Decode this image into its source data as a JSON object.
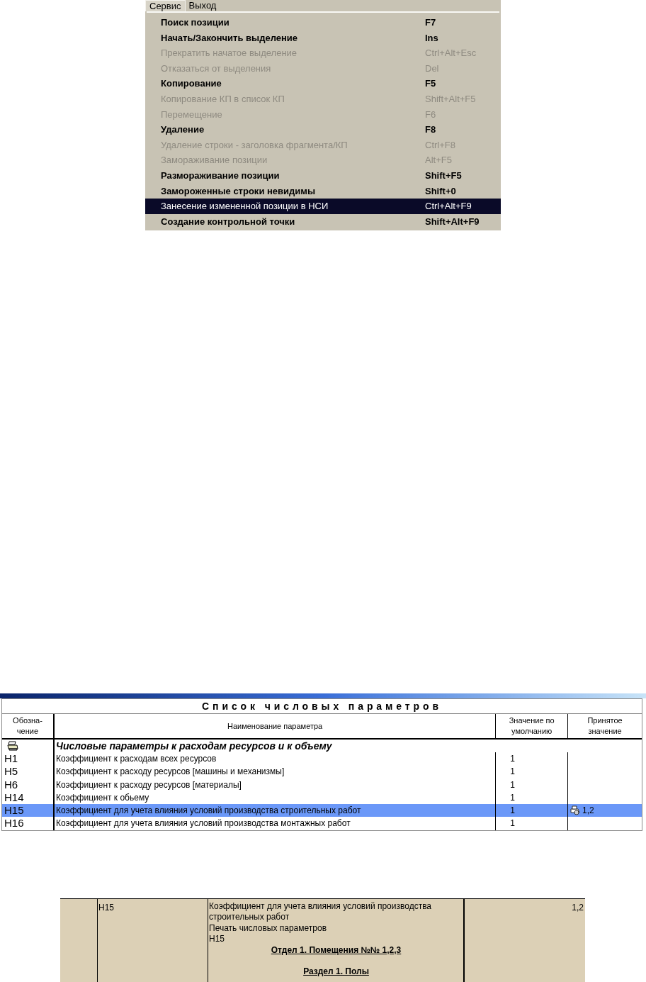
{
  "menu": {
    "menubar": [
      {
        "label": "Сервис",
        "selected": true
      },
      {
        "label": "Выход",
        "selected": false
      }
    ],
    "items": [
      {
        "label": "Поиск позиции",
        "shortcut": "F7",
        "disabled": false,
        "selected": false
      },
      {
        "label": "Начать/Закончить выделение",
        "shortcut": "Ins",
        "disabled": false,
        "selected": false
      },
      {
        "label": "Прекратить начатое выделение",
        "shortcut": "Ctrl+Alt+Esc",
        "disabled": true,
        "selected": false
      },
      {
        "label": "Отказаться от выделения",
        "shortcut": "Del",
        "disabled": true,
        "selected": false
      },
      {
        "label": "Копирование",
        "shortcut": "F5",
        "disabled": false,
        "selected": false
      },
      {
        "label": "Копирование КП в список КП",
        "shortcut": "Shift+Alt+F5",
        "disabled": true,
        "selected": false
      },
      {
        "label": "Перемещение",
        "shortcut": "F6",
        "disabled": true,
        "selected": false
      },
      {
        "label": "Удаление",
        "shortcut": "F8",
        "disabled": false,
        "selected": false
      },
      {
        "label": "Удаление строки - заголовка фрагмента/КП",
        "shortcut": "Ctrl+F8",
        "disabled": true,
        "selected": false
      },
      {
        "label": "Замораживание позиции",
        "shortcut": "Alt+F5",
        "disabled": true,
        "selected": false
      },
      {
        "label": "Размораживание позиции",
        "shortcut": "Shift+F5",
        "disabled": false,
        "selected": false
      },
      {
        "label": "Замороженные строки невидимы",
        "shortcut": "Shift+0",
        "disabled": false,
        "selected": false
      },
      {
        "label": "Занесение измененной позиции в НСИ",
        "shortcut": "Ctrl+Alt+F9",
        "disabled": false,
        "selected": true
      },
      {
        "label": "Создание контрольной точки",
        "shortcut": "Shift+Alt+F9",
        "disabled": false,
        "selected": false
      }
    ]
  },
  "table": {
    "title": "Список числовых параметров",
    "columns": [
      "Обозна-\nчение",
      "Наименование параметра",
      "Значение по\nумолчанию",
      "Принятое\nзначение"
    ],
    "group": {
      "label": "Числовые параметры к расходам ресурсов и к объему"
    },
    "rows": [
      {
        "code": "H1",
        "name": "Коэффициент к расходам всех ресурсов",
        "default": "1",
        "selected": false
      },
      {
        "code": "H5",
        "name": "Коэффициент к расходу ресурсов [машины и механизмы]",
        "default": "1",
        "selected": false
      },
      {
        "code": "H6",
        "name": "Коэффициент к расходу ресурсов [материалы]",
        "default": "1",
        "selected": false
      },
      {
        "code": "H14",
        "name": "Коэффициент к обьему",
        "default": "1",
        "selected": false
      },
      {
        "code": "H15",
        "name": "Коэффициент для учета влияния условий производства строительных работ",
        "default": "1",
        "accepted": "1,2",
        "selected": true
      },
      {
        "code": "H16",
        "name": "Коэффициент для учета влияния условий производства монтажных работ",
        "default": "1",
        "selected": false
      }
    ]
  },
  "report": {
    "code": "H15",
    "lines": [
      "Коэффициент для учета влияния условий производства строительных работ",
      "Печать числовых параметров",
      "H15"
    ],
    "headings": [
      "Отдел 1. Помещения №№ 1,2,3",
      "Раздел 1. Полы"
    ],
    "value": "1,2"
  }
}
